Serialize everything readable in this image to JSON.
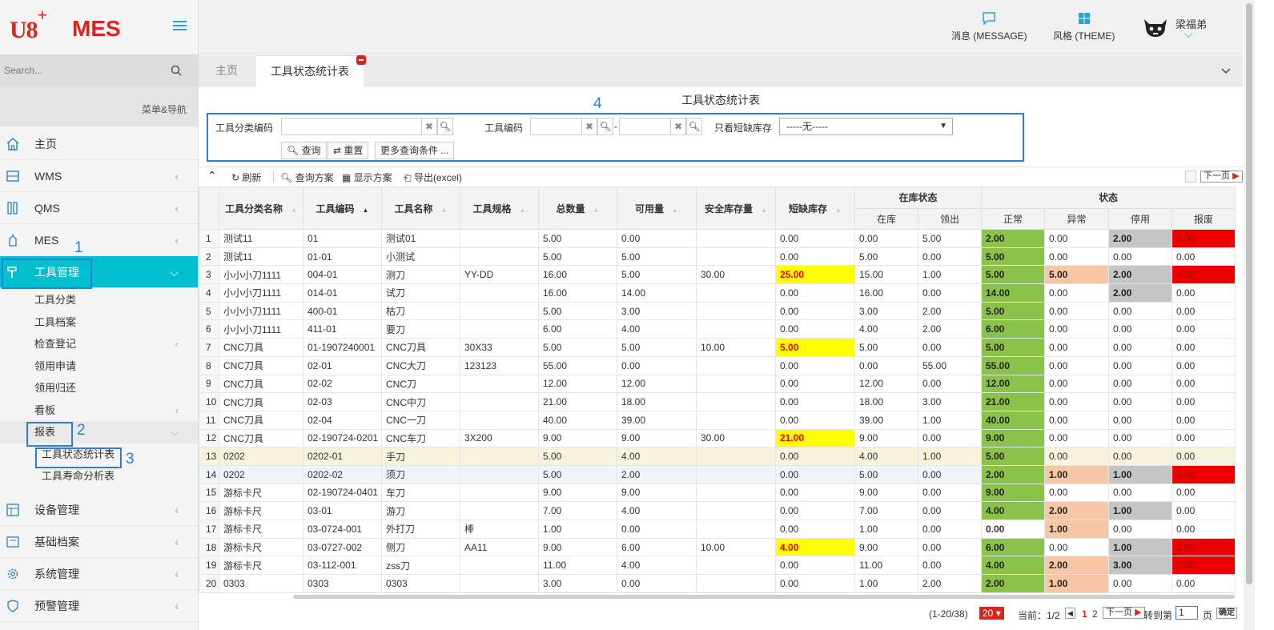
{
  "logo": {
    "brand": "U8",
    "plus": "+",
    "product": "MES"
  },
  "search": {
    "placeholder": "Search..."
  },
  "menu_nav_label": "菜单&导航",
  "sidebar": {
    "items": [
      {
        "label": "主页",
        "icon": "home-icon"
      },
      {
        "label": "WMS",
        "icon": "warehouse-icon"
      },
      {
        "label": "QMS",
        "icon": "quality-icon"
      },
      {
        "label": "MES",
        "icon": "factory-icon"
      },
      {
        "label": "工具管理",
        "icon": "hammer-icon",
        "active": true
      }
    ],
    "tool_sub": [
      "工具分类",
      "工具档案",
      "检查登记",
      "领用申请",
      "领用归还",
      "看板",
      "报表"
    ],
    "report_sub": [
      "工具状态统计表",
      "工具寿命分析表"
    ],
    "items_after": [
      {
        "label": "设备管理",
        "icon": "equipment-icon"
      },
      {
        "label": "基础档案",
        "icon": "archive-icon"
      },
      {
        "label": "系统管理",
        "icon": "gear-icon"
      },
      {
        "label": "预警管理",
        "icon": "shield-icon"
      }
    ]
  },
  "callouts": [
    "1",
    "2",
    "3",
    "4"
  ],
  "header": {
    "message_label": "消息 (MESSAGE)",
    "theme_label": "风格 (THEME)",
    "user_name": "梁福弟"
  },
  "tabs": {
    "home": "主页",
    "active": "工具状态统计表"
  },
  "page_title": "工具状态统计表",
  "filter": {
    "category_label": "工具分类编码",
    "code_label": "工具编码",
    "range_sep": "-",
    "shortage_label": "只看短缺库存",
    "shortage_value": "-----无-----",
    "query_btn": "查询",
    "reset_btn": "重置",
    "more_btn": "更多查询条件 ..."
  },
  "toolbar": {
    "refresh": "刷新",
    "query_scheme": "查询方案",
    "display_scheme": "显示方案",
    "export": "导出(excel)",
    "next_page": "下一页"
  },
  "table": {
    "headers": [
      "工具分类名称",
      "工具编码",
      "工具名称",
      "工具规格",
      "总数量",
      "可用量",
      "安全库存量",
      "短缺库存"
    ],
    "group_stock": "在库状态",
    "stock_cols": [
      "在库",
      "领出"
    ],
    "group_status": "状态",
    "status_cols": [
      "正常",
      "异常",
      "停用",
      "报废"
    ],
    "rows": [
      [
        "1",
        "测试11",
        "01",
        "测试01",
        "",
        "5.00",
        "0.00",
        "",
        "0.00",
        "0.00",
        "5.00",
        "2.00",
        "0.00",
        "2.00",
        "1.00"
      ],
      [
        "2",
        "测试11",
        "01-01",
        "小测试",
        "",
        "5.00",
        "5.00",
        "",
        "0.00",
        "5.00",
        "0.00",
        "5.00",
        "0.00",
        "0.00",
        "0.00"
      ],
      [
        "3",
        "小小小刀1111",
        "004-01",
        "测刀",
        "YY-DD",
        "16.00",
        "5.00",
        "30.00",
        "25.00",
        "15.00",
        "1.00",
        "5.00",
        "5.00",
        "2.00",
        "4.00"
      ],
      [
        "4",
        "小小小刀1111",
        "014-01",
        "试刀",
        "",
        "16.00",
        "14.00",
        "",
        "0.00",
        "16.00",
        "0.00",
        "14.00",
        "0.00",
        "2.00",
        "0.00"
      ],
      [
        "5",
        "小小小刀1111",
        "400-01",
        "枯刀",
        "",
        "5.00",
        "3.00",
        "",
        "0.00",
        "3.00",
        "2.00",
        "5.00",
        "0.00",
        "0.00",
        "0.00"
      ],
      [
        "6",
        "小小小刀1111",
        "411-01",
        "要刀",
        "",
        "6.00",
        "4.00",
        "",
        "0.00",
        "4.00",
        "2.00",
        "6.00",
        "0.00",
        "0.00",
        "0.00"
      ],
      [
        "7",
        "CNC刀具",
        "01-1907240001",
        "CNC刀具",
        "30X33",
        "5.00",
        "5.00",
        "10.00",
        "5.00",
        "5.00",
        "0.00",
        "5.00",
        "0.00",
        "0.00",
        "0.00"
      ],
      [
        "8",
        "CNC刀具",
        "02-01",
        "CNC大刀",
        "123123",
        "55.00",
        "0.00",
        "",
        "0.00",
        "0.00",
        "55.00",
        "55.00",
        "0.00",
        "0.00",
        "0.00"
      ],
      [
        "9",
        "CNC刀具",
        "02-02",
        "CNC刀",
        "",
        "12.00",
        "12.00",
        "",
        "0.00",
        "12.00",
        "0.00",
        "12.00",
        "0.00",
        "0.00",
        "0.00"
      ],
      [
        "10",
        "CNC刀具",
        "02-03",
        "CNC中刀",
        "",
        "21.00",
        "18.00",
        "",
        "0.00",
        "18.00",
        "3.00",
        "21.00",
        "0.00",
        "0.00",
        "0.00"
      ],
      [
        "11",
        "CNC刀具",
        "02-04",
        "CNC一刀",
        "",
        "40.00",
        "39.00",
        "",
        "0.00",
        "39.00",
        "1.00",
        "40.00",
        "0.00",
        "0.00",
        "0.00"
      ],
      [
        "12",
        "CNC刀具",
        "02-190724-0201",
        "CNC车刀",
        "3X200",
        "9.00",
        "9.00",
        "30.00",
        "21.00",
        "9.00",
        "0.00",
        "9.00",
        "0.00",
        "0.00",
        "0.00"
      ],
      [
        "13",
        "0202",
        "0202-01",
        "手刀",
        "",
        "5.00",
        "4.00",
        "",
        "0.00",
        "4.00",
        "1.00",
        "5.00",
        "0.00",
        "0.00",
        "0.00"
      ],
      [
        "14",
        "0202",
        "0202-02",
        "须刀",
        "",
        "5.00",
        "2.00",
        "",
        "0.00",
        "5.00",
        "0.00",
        "2.00",
        "1.00",
        "1.00",
        "1.00"
      ],
      [
        "15",
        "游标卡尺",
        "02-190724-0401",
        "车刀",
        "",
        "9.00",
        "9.00",
        "",
        "0.00",
        "9.00",
        "0.00",
        "9.00",
        "0.00",
        "0.00",
        "0.00"
      ],
      [
        "16",
        "游标卡尺",
        "03-01",
        "游刀",
        "",
        "7.00",
        "4.00",
        "",
        "0.00",
        "7.00",
        "0.00",
        "4.00",
        "2.00",
        "1.00",
        "0.00"
      ],
      [
        "17",
        "游标卡尺",
        "03-0724-001",
        "外打刀",
        "棒",
        "1.00",
        "0.00",
        "",
        "0.00",
        "1.00",
        "0.00",
        "0.00",
        "1.00",
        "0.00",
        "0.00"
      ],
      [
        "18",
        "游标卡尺",
        "03-0727-002",
        "侧刀",
        "AA11",
        "9.00",
        "6.00",
        "10.00",
        "4.00",
        "9.00",
        "0.00",
        "6.00",
        "0.00",
        "1.00",
        "2.00"
      ],
      [
        "19",
        "游标卡尺",
        "03-112-001",
        "zss刀",
        "",
        "11.00",
        "4.00",
        "",
        "0.00",
        "11.00",
        "0.00",
        "4.00",
        "2.00",
        "3.00",
        "2.00"
      ],
      [
        "20",
        "0303",
        "0303",
        "0303",
        "",
        "3.00",
        "0.00",
        "",
        "0.00",
        "1.00",
        "2.00",
        "2.00",
        "1.00",
        "0.00",
        "0.00"
      ]
    ]
  },
  "pager": {
    "range": "(1-20/38)",
    "page_size": "20",
    "current_label": "当前：1/2",
    "page1": "1",
    "page2": "2",
    "next": "下一页",
    "goto_label": "转到第",
    "goto_value": "1",
    "page_unit": "页",
    "confirm": "确定"
  },
  "colors": {
    "accent": "#00bfcf",
    "brand": "#d9261c",
    "normal": "#8bc34a",
    "abnormal": "#f7c6a5",
    "disabled": "#c5c5c5",
    "scrapped": "#ee0000",
    "shortage": "#ffff00"
  }
}
